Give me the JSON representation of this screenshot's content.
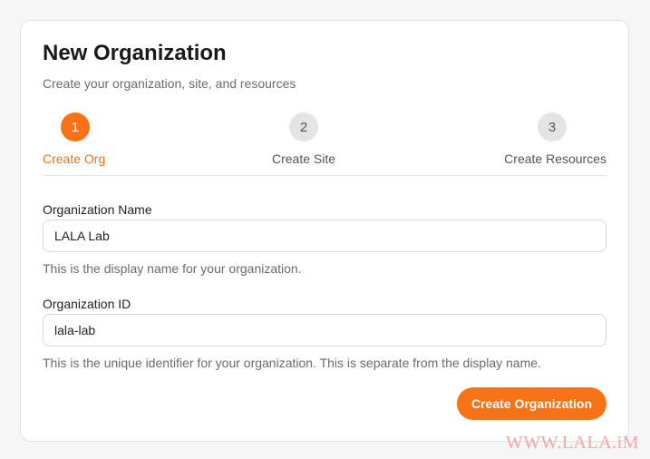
{
  "header": {
    "title": "New Organization",
    "subtitle": "Create your organization, site, and resources"
  },
  "steps": [
    {
      "number": "1",
      "label": "Create Org",
      "state": "active"
    },
    {
      "number": "2",
      "label": "Create Site",
      "state": "inactive"
    },
    {
      "number": "3",
      "label": "Create Resources",
      "state": "inactive"
    }
  ],
  "form": {
    "org_name": {
      "label": "Organization Name",
      "value": "LALA Lab",
      "help": "This is the display name for your organization."
    },
    "org_id": {
      "label": "Organization ID",
      "value": "lala-lab",
      "help": "This is the unique identifier for your organization. This is separate from the display name."
    },
    "submit_label": "Create Organization"
  },
  "watermark": "WWW.LALA.iM",
  "colors": {
    "accent": "#f97316",
    "inactive_step": "#e4e4e4"
  }
}
